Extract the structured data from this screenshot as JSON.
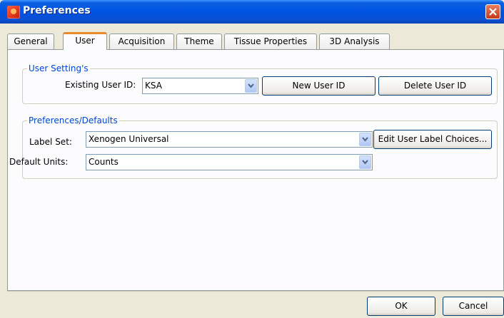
{
  "window": {
    "title": "Preferences",
    "app_icon": "app-icon",
    "close_icon": "close-icon"
  },
  "tabs": [
    {
      "label": "General",
      "active": false
    },
    {
      "label": "User",
      "active": true
    },
    {
      "label": "Acquisition",
      "active": false
    },
    {
      "label": "Theme",
      "active": false
    },
    {
      "label": "Tissue Properties",
      "active": false
    },
    {
      "label": "3D Analysis",
      "active": false
    }
  ],
  "user_settings": {
    "legend": "User Setting's",
    "existing_user_label": "Existing User ID:",
    "existing_user_value": "KSA",
    "new_user_button": "New User ID",
    "delete_user_button": "Delete User ID"
  },
  "preferences": {
    "legend": "Preferences/Defaults",
    "label_set_label": "Label Set:",
    "label_set_value": "Xenogen Universal",
    "edit_label_button": "Edit User Label Choices...",
    "default_units_label": "Default Units:",
    "default_units_value": "Counts"
  },
  "footer": {
    "ok": "OK",
    "cancel": "Cancel"
  },
  "colors": {
    "title_bar": "#0054e3",
    "legend_text": "#0046d5",
    "active_tab_accent": "#e68b2c",
    "dialog_bg": "#ece9d8"
  }
}
